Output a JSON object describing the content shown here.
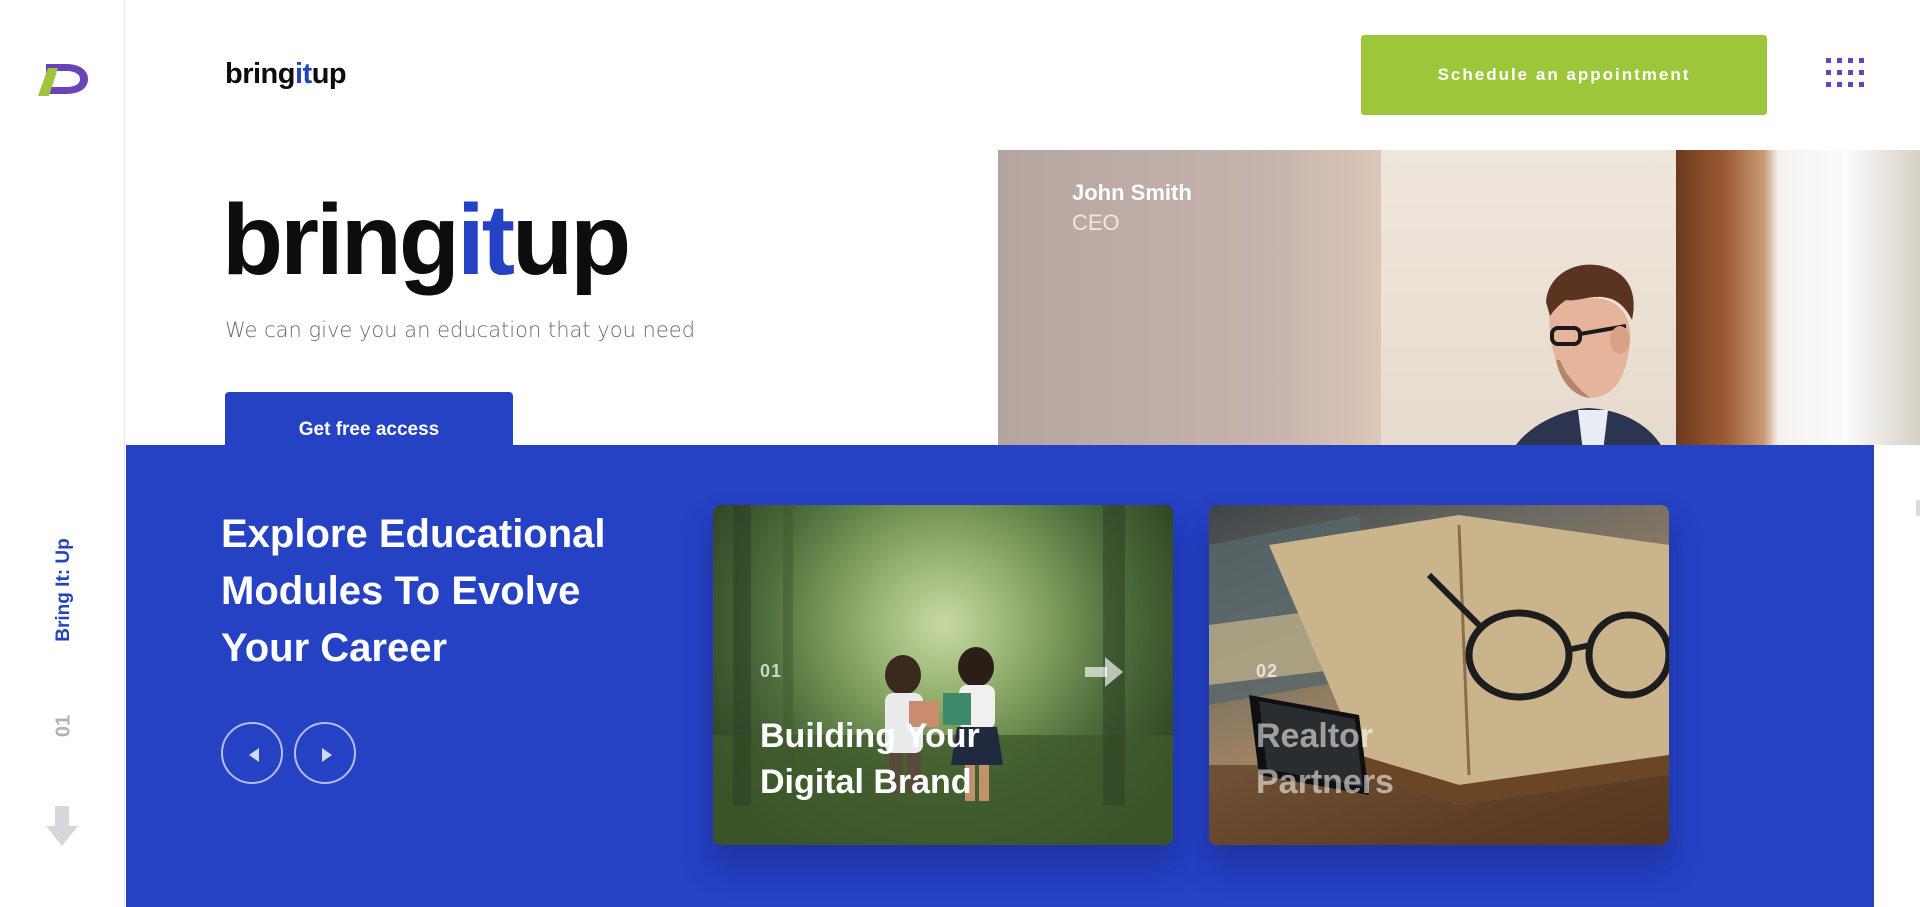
{
  "header": {
    "brand_pre": "bring",
    "brand_hl": "it",
    "brand_post": "up",
    "cta_label": "Schedule an appointment"
  },
  "rail": {
    "brand_label": "Bring It: Up",
    "slide_index": "01"
  },
  "hero": {
    "title_pre": "bring",
    "title_hl": "it",
    "title_post": "up",
    "subtitle": "We can give you an education that you need",
    "button_label": "Get free access",
    "person_name": "John Smith",
    "person_role": "CEO"
  },
  "modules": {
    "heading": "Explore Educational Modules To Evolve Your Career",
    "cards": [
      {
        "number": "01",
        "title": "Building Your Digital Brand"
      },
      {
        "number": "02",
        "title": "Realtor Partners"
      }
    ]
  },
  "colors": {
    "accent_blue": "#2541c4",
    "cta_green": "#9dc63b",
    "menu_purple": "#6a43b8"
  },
  "icons": [
    "logo-icon",
    "menu-grid-icon",
    "arrow-down-icon",
    "prev-arrow-icon",
    "next-arrow-icon",
    "card-arrow-icon"
  ]
}
